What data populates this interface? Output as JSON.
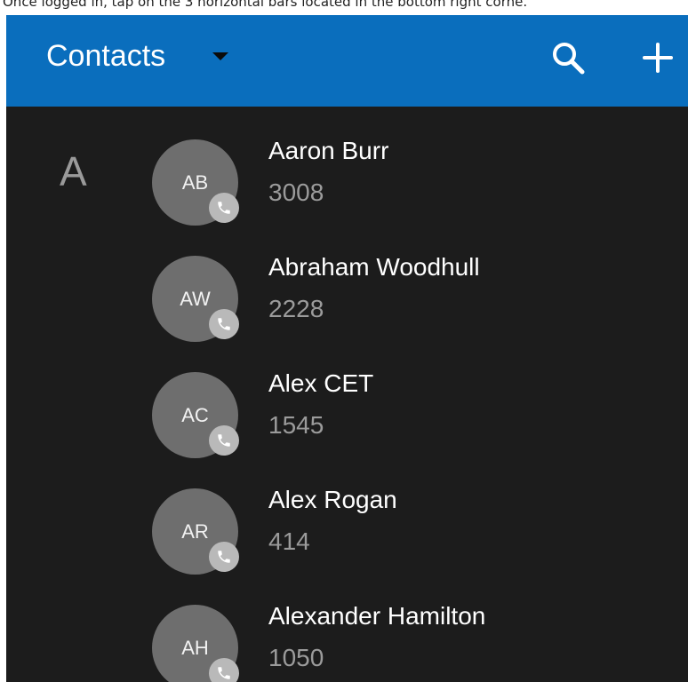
{
  "instruction_text": "Once logged in, tap on the 3 horizontal bars located in the bottom right corne.",
  "appbar": {
    "title": "Contacts",
    "background_color": "#0a6ebd",
    "dropdown_icon": "caret-down-icon",
    "search_icon": "search-icon",
    "add_icon": "plus-icon"
  },
  "section": {
    "letter": "A"
  },
  "contacts": [
    {
      "initials": "AB",
      "name": "Aaron Burr",
      "number": "3008",
      "badge_icon": "phone-icon"
    },
    {
      "initials": "AW",
      "name": "Abraham Woodhull",
      "number": "2228",
      "badge_icon": "phone-icon"
    },
    {
      "initials": "AC",
      "name": "Alex CET",
      "number": "1545",
      "badge_icon": "phone-icon"
    },
    {
      "initials": "AR",
      "name": "Alex Rogan",
      "number": "414",
      "badge_icon": "phone-icon"
    },
    {
      "initials": "AH",
      "name": "Alexander Hamilton",
      "number": "1050",
      "badge_icon": "phone-icon"
    }
  ],
  "colors": {
    "list_background": "#1c1c1c",
    "avatar": "#6e6e6e",
    "call_badge": "#b9b9b9",
    "name_text": "#ffffff",
    "number_text": "#9b9b9b"
  }
}
